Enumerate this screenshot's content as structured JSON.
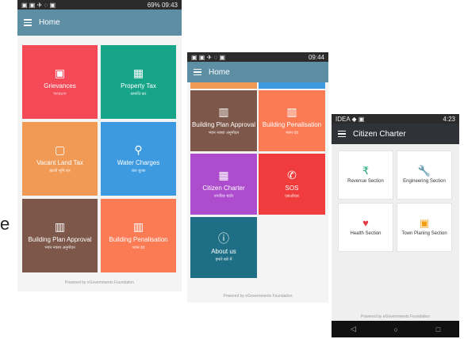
{
  "stray_letter": "e",
  "screen1": {
    "status_time": "09:43",
    "status_battery": "69%",
    "title": "Home",
    "tiles": [
      {
        "label": "Grievances",
        "sub": "ফিরিয়াদ",
        "icon": "inbox-icon",
        "glyph": "▣",
        "color": "#f44957"
      },
      {
        "label": "Property Tax",
        "sub": "सम्पत्ति कर",
        "icon": "building-icon",
        "glyph": "▦",
        "color": "#17a589"
      },
      {
        "label": "Vacant Land Tax",
        "sub": "खाली भूमि कर",
        "icon": "land-icon",
        "glyph": "▢",
        "color": "#f09a56"
      },
      {
        "label": "Water Charges",
        "sub": "जल शुल्क",
        "icon": "tap-icon",
        "glyph": "⚲",
        "color": "#3d9ae0"
      },
      {
        "label": "Building Plan Approval",
        "sub": "भवन नक्शा अनुमोदन",
        "icon": "building-plan-icon",
        "glyph": "▥",
        "color": "#7d5749"
      },
      {
        "label": "Building Penalisation",
        "sub": "भवन दंड",
        "icon": "buildings-icon",
        "glyph": "▥",
        "color": "#fb7b55"
      }
    ],
    "footer": "Powered by eGovernments Foundation"
  },
  "screen2": {
    "status_time": "09:44",
    "title": "Home",
    "tiles": [
      {
        "label": "Building Plan Approval",
        "sub": "भवन नक्शा अनुमोदन",
        "icon": "building-plan-icon",
        "glyph": "▥",
        "color": "#7d5749"
      },
      {
        "label": "Building Penalisation",
        "sub": "भवन दंड",
        "icon": "buildings-icon",
        "glyph": "▥",
        "color": "#fb7b55"
      },
      {
        "label": "Citizen Charter",
        "sub": "नागरिक चार्टर",
        "icon": "grid-icon",
        "glyph": "▦",
        "color": "#ad4ccc"
      },
      {
        "label": "SOS",
        "sub": "एसओएस",
        "icon": "phone-icon",
        "glyph": "✆",
        "color": "#f03c3c"
      },
      {
        "label": "About us",
        "sub": "हमारे बारे में",
        "icon": "info-icon",
        "glyph": "ⓘ",
        "color": "#1e6f86"
      }
    ],
    "footer": "Powered by eGovernments Foundation"
  },
  "screen3": {
    "status_carrier": "IDEA",
    "status_time": "4:23",
    "title": "Citizen Charter",
    "cards": [
      {
        "label": "Revenue Section",
        "icon": "rupee-icon",
        "glyph": "₹",
        "color": "#1aa37a"
      },
      {
        "label": "Engineering Section",
        "icon": "wrench-icon",
        "glyph": "🔧",
        "color": "#2e86d6"
      },
      {
        "label": "Health Section",
        "icon": "heart-pulse-icon",
        "glyph": "♥",
        "color": "#e53945"
      },
      {
        "label": "Town Planing Section",
        "icon": "town-icon",
        "glyph": "▣",
        "color": "#f39c12"
      }
    ],
    "footer": "Powered by eGovernments Foundation",
    "nav": {
      "back": "◁",
      "home": "○",
      "recent": "□"
    }
  }
}
